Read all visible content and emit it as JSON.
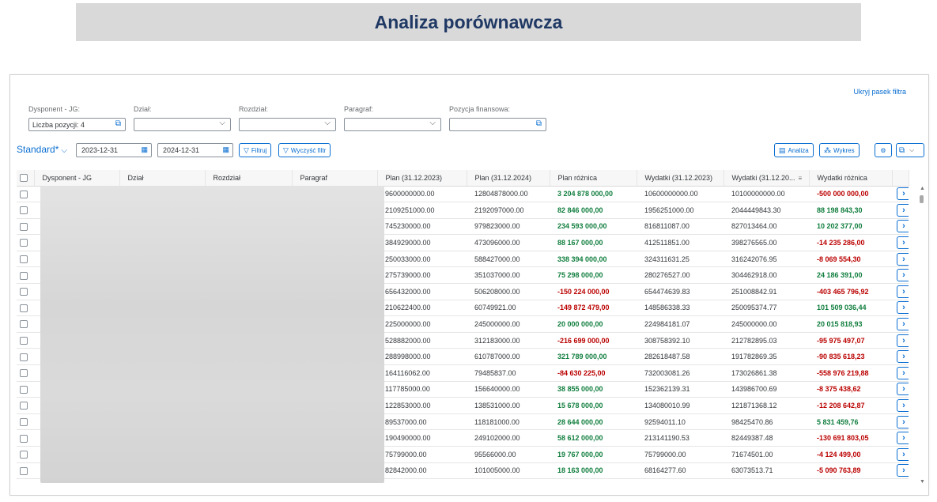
{
  "banner": {
    "title": "Analiza porównawcza"
  },
  "filter": {
    "hide_label": "Ukryj pasek filtra",
    "fields": [
      {
        "label": "Dysponent - JG:",
        "value": "Liczba pozycji: 4"
      },
      {
        "label": "Dział:",
        "value": ""
      },
      {
        "label": "Rozdział:",
        "value": ""
      },
      {
        "label": "Paragraf:",
        "value": ""
      },
      {
        "label": "Pozycja finansowa:",
        "value": ""
      }
    ]
  },
  "toolbar": {
    "variant": "Standard*",
    "date_from": "2023-12-31",
    "date_to": "2024-12-31",
    "filter_label": "Filtruj",
    "clear_label": "Wyczyść filtr",
    "analysis_label": "Analiza",
    "chart_label": "Wykres"
  },
  "table": {
    "columns": [
      "Dysponent - JG",
      "Dział",
      "Rozdział",
      "Paragraf",
      "Plan (31.12.2023)",
      "Plan (31.12.2024)",
      "Plan różnica",
      "Wydatki (31.12.2023)",
      "Wydatki (31.12.20...",
      "Wydatki różnica"
    ],
    "rows": [
      [
        "9600000000.00",
        "12804878000.00",
        "3 204 878 000,00",
        "10600000000.00",
        "10100000000.00",
        "-500 000 000,00"
      ],
      [
        "2109251000.00",
        "2192097000.00",
        "82 846 000,00",
        "1956251000.00",
        "2044449843.30",
        "88 198 843,30"
      ],
      [
        "745230000.00",
        "979823000.00",
        "234 593 000,00",
        "816811087.00",
        "827013464.00",
        "10 202 377,00"
      ],
      [
        "384929000.00",
        "473096000.00",
        "88 167 000,00",
        "412511851.00",
        "398276565.00",
        "-14 235 286,00"
      ],
      [
        "250033000.00",
        "588427000.00",
        "338 394 000,00",
        "324311631.25",
        "316242076.95",
        "-8 069 554,30"
      ],
      [
        "275739000.00",
        "351037000.00",
        "75 298 000,00",
        "280276527.00",
        "304462918.00",
        "24 186 391,00"
      ],
      [
        "656432000.00",
        "506208000.00",
        "-150 224 000,00",
        "654474639.83",
        "251008842.91",
        "-403 465 796,92"
      ],
      [
        "210622400.00",
        "60749921.00",
        "-149 872 479,00",
        "148586338.33",
        "250095374.77",
        "101 509 036,44"
      ],
      [
        "225000000.00",
        "245000000.00",
        "20 000 000,00",
        "224984181.07",
        "245000000.00",
        "20 015 818,93"
      ],
      [
        "528882000.00",
        "312183000.00",
        "-216 699 000,00",
        "308758392.10",
        "212782895.03",
        "-95 975 497,07"
      ],
      [
        "288998000.00",
        "610787000.00",
        "321 789 000,00",
        "282618487.58",
        "191782869.35",
        "-90 835 618,23"
      ],
      [
        "164116062.00",
        "79485837.00",
        "-84 630 225,00",
        "732003081.26",
        "173026861.38",
        "-558 976 219,88"
      ],
      [
        "117785000.00",
        "156640000.00",
        "38 855 000,00",
        "152362139.31",
        "143986700.69",
        "-8 375 438,62"
      ],
      [
        "122853000.00",
        "138531000.00",
        "15 678 000,00",
        "134080010.99",
        "121871368.12",
        "-12 208 642,87"
      ],
      [
        "89537000.00",
        "118181000.00",
        "28 644 000,00",
        "92594011.10",
        "98425470.86",
        "5 831 459,76"
      ],
      [
        "190490000.00",
        "249102000.00",
        "58 612 000,00",
        "213141190.53",
        "82449387.48",
        "-130 691 803,05"
      ],
      [
        "75799000.00",
        "95566000.00",
        "19 767 000,00",
        "75799000.00",
        "71674501.00",
        "-4 124 499,00"
      ],
      [
        "82842000.00",
        "101005000.00",
        "18 163 000,00",
        "68164277.60",
        "63073513.71",
        "-5 090 763,89"
      ]
    ]
  },
  "colors": {
    "accent": "#0a6ed1",
    "positive": "#107e3e",
    "negative": "#bb0000",
    "banner_bg": "#d9d9d9",
    "banner_text": "#1f3864"
  }
}
